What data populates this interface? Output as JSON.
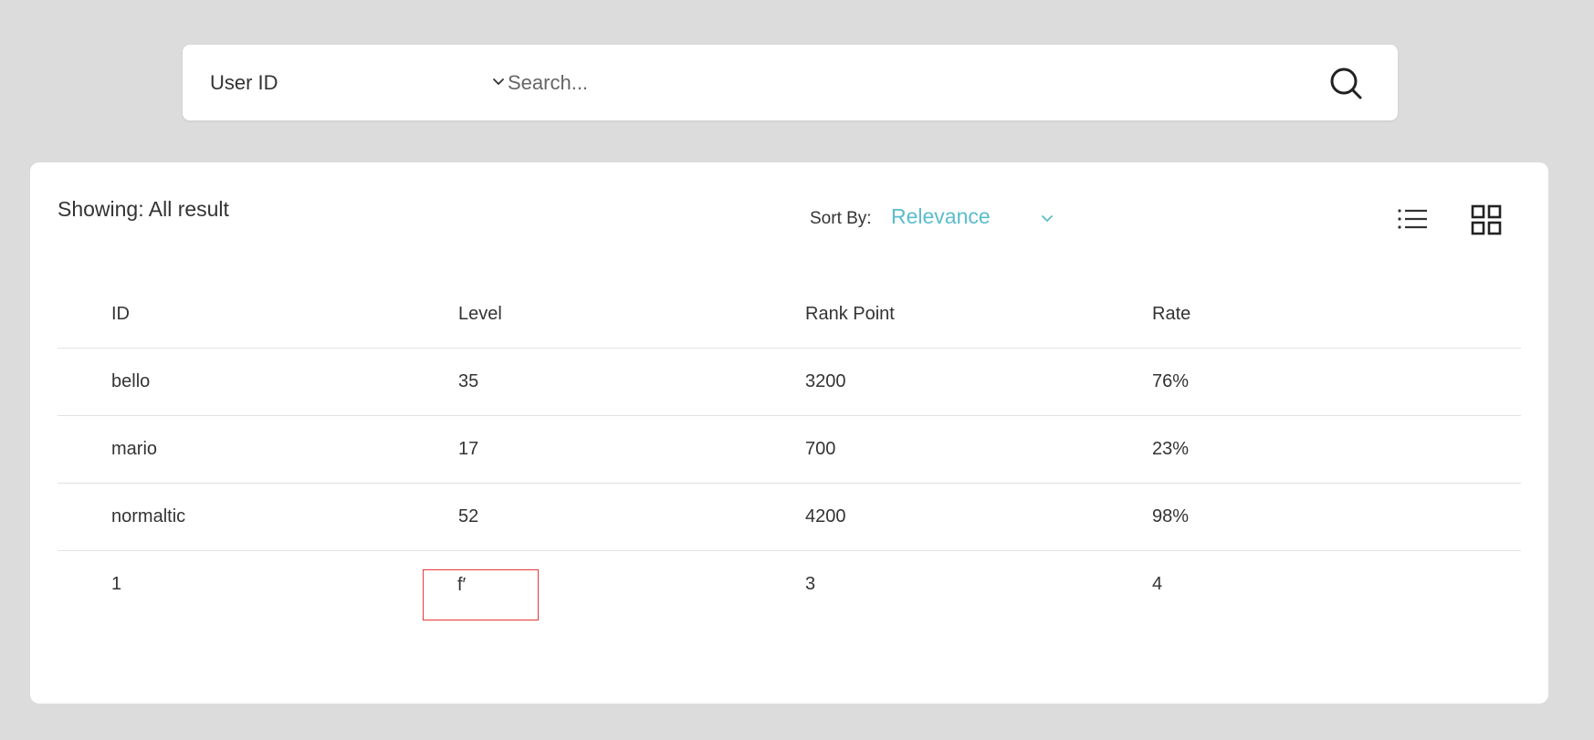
{
  "search": {
    "field_selected": "User ID",
    "placeholder": "Search...",
    "value": ""
  },
  "results": {
    "showing_text": "Showing: All result",
    "sort_label": "Sort By:",
    "sort_value": "Relevance",
    "accent_color": "#5bbccc",
    "view_icons": [
      "list-view-icon",
      "grid-view-icon"
    ]
  },
  "table": {
    "headers": [
      "ID",
      "Level",
      "Rank Point",
      "Rate"
    ],
    "rows": [
      [
        "bello",
        "35",
        "3200",
        "76%"
      ],
      [
        "mario",
        "17",
        "700",
        "23%"
      ],
      [
        "normaltic",
        "52",
        "4200",
        "98%"
      ],
      [
        "1",
        "f′",
        "3",
        "4"
      ]
    ],
    "editing_cell_border": "#e53935"
  }
}
